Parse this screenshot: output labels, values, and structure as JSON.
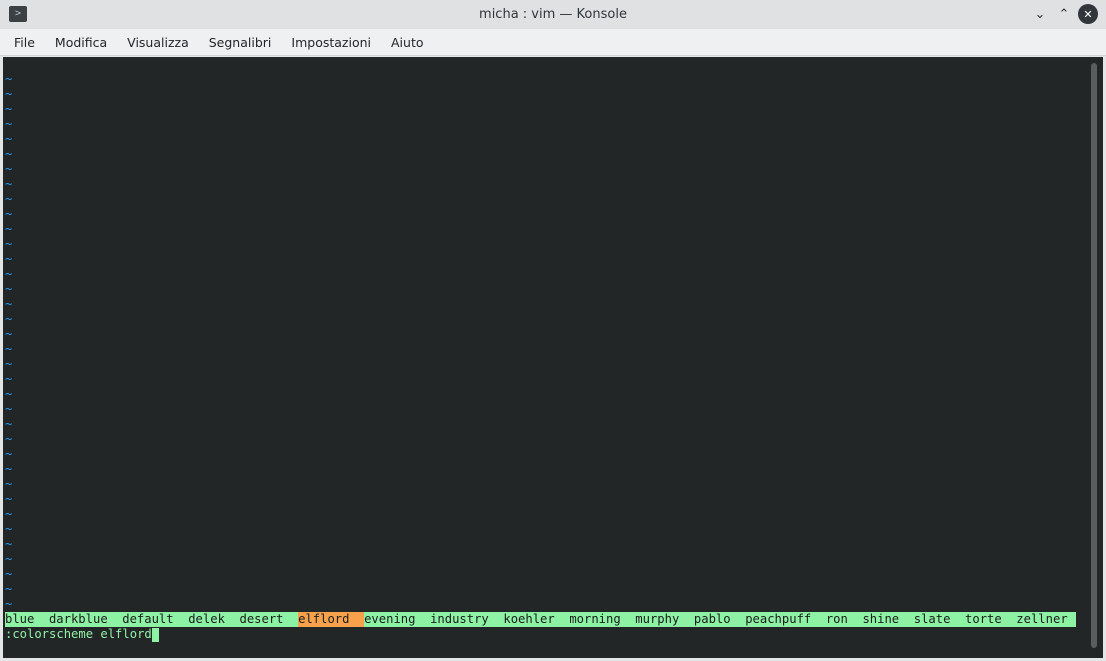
{
  "window": {
    "title": "micha : vim — Konsole",
    "app_icon": ">",
    "controls": {
      "minimize": "⌄",
      "maximize": "⌃",
      "close": "✕"
    }
  },
  "menubar": {
    "items": [
      "File",
      "Modifica",
      "Visualizza",
      "Segnalibri",
      "Impostazioni",
      "Aiuto"
    ]
  },
  "terminal": {
    "tilde_char": "~",
    "tilde_count": 36,
    "wildmenu": {
      "items": [
        "blue",
        "darkblue",
        "default",
        "delek",
        "desert",
        "elflord",
        "evening",
        "industry",
        "koehler",
        "morning",
        "murphy",
        "pablo",
        "peachpuff",
        "ron",
        "shine",
        "slate",
        "torte",
        "zellner"
      ],
      "selected": "elflord"
    },
    "command_line": ":colorscheme elflord",
    "colors": {
      "background": "#232627",
      "tilde": "#1d99f3",
      "wildmenu_bg": "#8ef2a4",
      "wildmenu_selected_bg": "#f7a14a"
    }
  }
}
